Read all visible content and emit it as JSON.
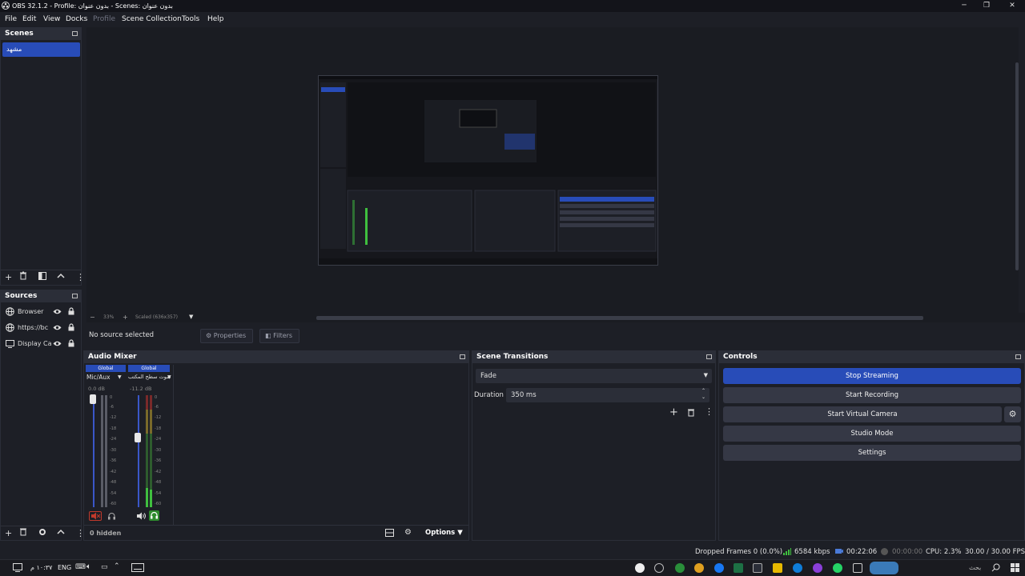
{
  "window": {
    "title": "OBS 32.1.2 - Profile: بدون عنوان - Scenes: بدون عنوان",
    "controls": {
      "minimize": "─",
      "restore": "❐",
      "close": "✕"
    }
  },
  "menu": [
    {
      "label": "File"
    },
    {
      "label": "Edit"
    },
    {
      "label": "View"
    },
    {
      "label": "Docks"
    },
    {
      "label": "Profile"
    },
    {
      "label": "Scene Collection"
    },
    {
      "label": "Tools"
    },
    {
      "label": "Help"
    }
  ],
  "scenes": {
    "title": "Scenes",
    "items": [
      {
        "label": "مشهد",
        "selected": true
      }
    ]
  },
  "sources": {
    "title": "Sources",
    "items": [
      {
        "label": "Browser",
        "icon": "globe-icon"
      },
      {
        "label": "https://bc",
        "icon": "globe-icon"
      },
      {
        "label": "Display Ca",
        "icon": "monitor-icon"
      }
    ]
  },
  "preview": {
    "zoom_minus": "−",
    "zoom_level": "33%",
    "zoom_plus": "+",
    "scale_label": "Scaled (636x357)"
  },
  "context": {
    "no_source": "No source selected",
    "properties": "Properties",
    "filters": "Filters"
  },
  "audio_mixer": {
    "title": "Audio Mixer",
    "hidden_label": "0 hidden",
    "options_label": "Options",
    "channels": [
      {
        "badge": "Global",
        "name": "Mic/Aux",
        "db": "0.0 dB",
        "muted": true,
        "volume_level": 0.95
      },
      {
        "badge": "Global",
        "name": "صوت سطح المكتب",
        "db": "-11.2 dB",
        "muted": false,
        "volume_level": 0.55
      }
    ],
    "scale": [
      "0",
      "-6",
      "-12",
      "-18",
      "-24",
      "-30",
      "-36",
      "-42",
      "-48",
      "-54",
      "-60"
    ]
  },
  "scene_transitions": {
    "title": "Scene Transitions",
    "selected": "Fade",
    "duration_label": "Duration",
    "duration_value": "350 ms"
  },
  "controls": {
    "title": "Controls",
    "buttons": {
      "stop_streaming": "Stop Streaming",
      "start_recording": "Start Recording",
      "start_virtual_camera": "Start Virtual Camera",
      "studio_mode": "Studio Mode",
      "settings": "Settings"
    }
  },
  "status": {
    "dropped_frames": "Dropped Frames 0 (0.0%)",
    "bitrate": "6584 kbps",
    "stream_time": "00:22:06",
    "record_time": "00:00:00",
    "cpu": "CPU: 2.3%",
    "fps": "30.00 / 30.00 FPS"
  },
  "taskbar": {
    "time": "١٠:٣٧ م",
    "lang": "ENG",
    "search_placeholder": "بحث"
  },
  "colors": {
    "accent": "#284cb8",
    "panel": "#1d1f26",
    "header": "#2b2e38",
    "meter_green": "#3fbf3f",
    "meter_red": "#c0392b"
  }
}
